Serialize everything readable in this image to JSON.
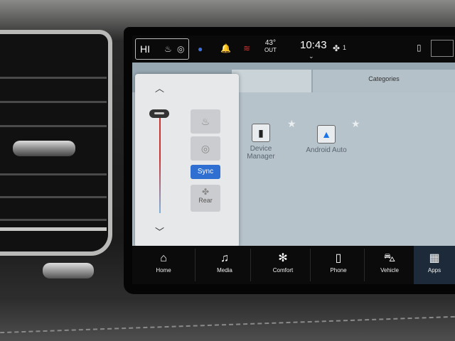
{
  "status_bar": {
    "hi_label": "HI",
    "temperature": "43°",
    "temperature_sub": "OUT",
    "clock": "10:43",
    "fan_indicator": "1"
  },
  "tabs": {
    "categories_label": "Categories"
  },
  "apps": [
    {
      "label_line1": "Device",
      "label_line2": "Manager",
      "icon": "device-manager-icon"
    },
    {
      "label_line1": "Android Auto",
      "label_line2": "",
      "icon": "android-auto-icon"
    }
  ],
  "climate_popup": {
    "sync_label": "Sync",
    "rear_label": "Rear",
    "fan_level": 0.97
  },
  "nav": [
    {
      "label": "Home",
      "icon": "home-icon"
    },
    {
      "label": "Media",
      "icon": "music-note-icon"
    },
    {
      "label": "Comfort",
      "icon": "comfort-icon"
    },
    {
      "label": "Phone",
      "icon": "phone-icon"
    },
    {
      "label": "Vehicle",
      "icon": "car-icon"
    },
    {
      "label": "Apps",
      "icon": "apps-grid-icon"
    }
  ],
  "colors": {
    "sync_active": "#2f6fd1",
    "heat_red": "#cc3333",
    "cool_blue": "#7fb2dc"
  }
}
